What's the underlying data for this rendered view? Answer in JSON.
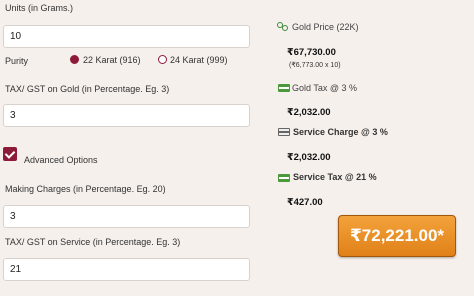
{
  "form": {
    "units_label": "Units (in Grams.)",
    "units_value": "10",
    "purity_label": "Purity",
    "purity_options": [
      "22 Karat (916)",
      "24 Karat (999)"
    ],
    "purity_selected": "22 Karat (916)",
    "tax_gold_label": "TAX/ GST on Gold (in Percentage. Eg. 3)",
    "tax_gold_value": "3",
    "advanced_label": "Advanced Options",
    "advanced_checked": true,
    "making_label": "Making Charges (in Percentage. Eg. 20)",
    "making_value": "3",
    "tax_service_label": "TAX/ GST on Service (in Percentage. Eg. 3)",
    "tax_service_value": "21"
  },
  "results": {
    "gold_price_label": "Gold Price (22K)",
    "gold_price_value": "₹67,730.00",
    "gold_price_sub": "(₹6,773.00 x 10)",
    "gold_tax_label": "Gold Tax @ 3 %",
    "gold_tax_value": "₹2,032.00",
    "service_charge_label": "Service Charge @ 3 %",
    "service_charge_value": "₹2,032.00",
    "service_tax_label": "Service Tax @ 21 %",
    "service_tax_value": "₹427.00",
    "total": "₹72,221.00*"
  },
  "colors": {
    "accent": "#8e1a3a",
    "button_gradient_top": "#f3a23c",
    "button_gradient_bottom": "#e08118",
    "icon_green": "#4a9a3c"
  },
  "icons": [
    "coins-icon",
    "cash-icon",
    "credit-card-icon",
    "checkbox-check-icon"
  ]
}
